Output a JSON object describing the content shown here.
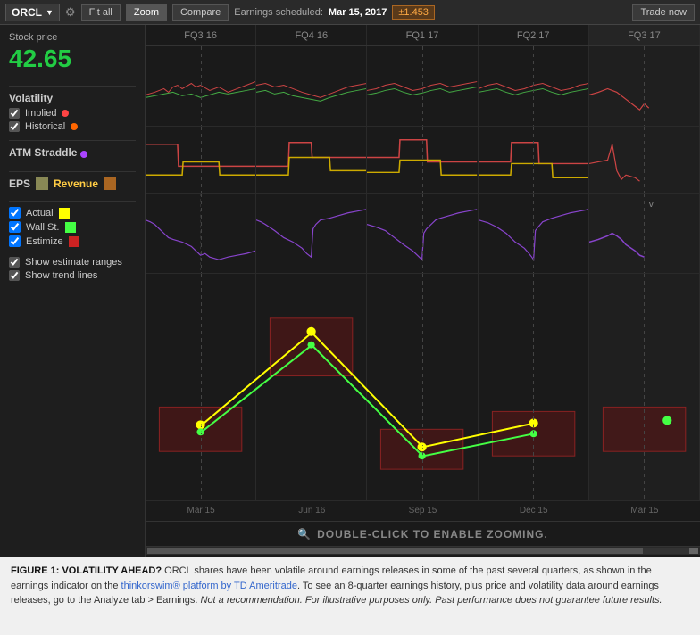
{
  "toolbar": {
    "ticker": "ORCL",
    "fit_all": "Fit all",
    "zoom": "Zoom",
    "compare": "Compare",
    "earnings_label": "Earnings scheduled:",
    "earnings_date": "Mar 15, 2017",
    "earnings_badge": "±1.453",
    "trade_now": "Trade now"
  },
  "left_panel": {
    "stock_price_label": "Stock price",
    "stock_price_value": "42.65",
    "volatility": {
      "title": "Volatility",
      "implied_label": "Implied",
      "implied_color": "#ff4444",
      "historical_label": "Historical",
      "historical_color": "#ff6600"
    },
    "atm": {
      "title": "ATM Straddle"
    },
    "eps": {
      "title": "EPS",
      "revenue_label": "Revenue",
      "actual_label": "Actual",
      "actual_color": "#ffff00",
      "wallst_label": "Wall St.",
      "wallst_color": "#44ff44",
      "estimize_label": "Estimize",
      "estimize_color": "#cc2222",
      "show_estimate_ranges": "Show estimate ranges",
      "show_trend_lines": "Show trend lines"
    }
  },
  "quarters": [
    "FQ3 16",
    "FQ4 16",
    "FQ1 17",
    "FQ2 17",
    "FQ3 17"
  ],
  "x_labels": [
    "Mar 15",
    "Jun 16",
    "Sep 15",
    "Dec 15",
    "Mar 15"
  ],
  "zoom_bar": "DOUBLE-CLICK TO ENABLE ZOOMING.",
  "figure": {
    "bold_part": "FIGURE 1: VOLATILITY AHEAD?",
    "text": " ORCL shares have been volatile around earnings releases in some of the past several quarters, as shown in the earnings indicator on the ",
    "link": "thinkorswim® platform by TD Ameritrade",
    "text2": ".  To see an 8-quarter earnings history, plus price and volatility data around earnings releases, go to the Analyze tab > Earnings.  ",
    "italic1": "Not a recommendation.",
    "text3": "  ",
    "italic2": "For illustrative purposes only. Past performance does not guarantee future results."
  }
}
